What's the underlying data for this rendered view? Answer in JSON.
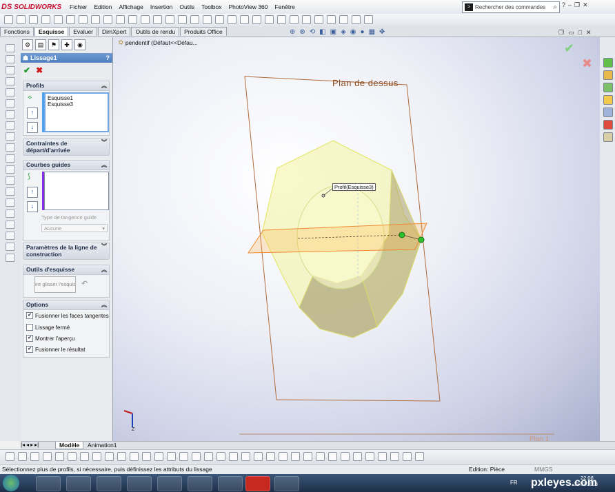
{
  "app": {
    "brand": "SOLIDWORKS",
    "brand_mark": "DS"
  },
  "menu": [
    "Fichier",
    "Edition",
    "Affichage",
    "Insertion",
    "Outils",
    "Toolbox",
    "PhotoView 360",
    "Fenêtre"
  ],
  "search": {
    "placeholder": "Rechercher des commandes"
  },
  "tabs": [
    "Fonctions",
    "Esquisse",
    "Evaluer",
    "DimXpert",
    "Outils de rendu",
    "Produits Office"
  ],
  "active_tab": "Esquisse",
  "tree": {
    "label": "pendentif  (Défaut<<Défau..."
  },
  "property_manager": {
    "title": "Lissage1",
    "help": "?",
    "ok": "✔",
    "cancel": "✖",
    "profils": {
      "header": "Profils",
      "items": [
        "Esquisse1",
        "Esquisse3"
      ]
    },
    "contraintes": {
      "header": "Contraintes de départ/d'arrivée"
    },
    "courbes": {
      "header": "Courbes guides",
      "tangency_label": "Type de tangence guide",
      "tangency_value": "Aucune"
    },
    "parametres": {
      "header": "Paramètres de la ligne de construction"
    },
    "outils": {
      "header": "Outils d'esquisse",
      "button": "ire glisser l'esquis"
    },
    "options": {
      "header": "Options",
      "items": [
        {
          "label": "Fusionner les faces tangentes",
          "checked": true
        },
        {
          "label": "Lissage fermé",
          "checked": false
        },
        {
          "label": "Montrer l'aperçu",
          "checked": true
        },
        {
          "label": "Fusionner le résultat",
          "checked": true
        }
      ]
    }
  },
  "graphics": {
    "plane_label": "Plan de dessus",
    "callout": "Profil(Esquisse3)",
    "bottom_plane_label": "Plan 1",
    "triad_axis": "Z"
  },
  "bottom_tabs": [
    "Modèle",
    "Animation1"
  ],
  "status": {
    "left": "Sélectionnez plus de profils, si nécessaire, puis définissez les attributs du lissage",
    "right": "Edition: Pièce",
    "units": "MMGS"
  },
  "taskbar": {
    "lang": "FR",
    "time": "22:08",
    "date": "13/07/2013",
    "watermark": "pxleyes.com"
  },
  "colors": {
    "accent": "#4f7fc0",
    "ok": "#1a9a2a",
    "cancel": "#cc1a1a",
    "plane": "#b06a3a",
    "preview": "#f3f3a0"
  }
}
